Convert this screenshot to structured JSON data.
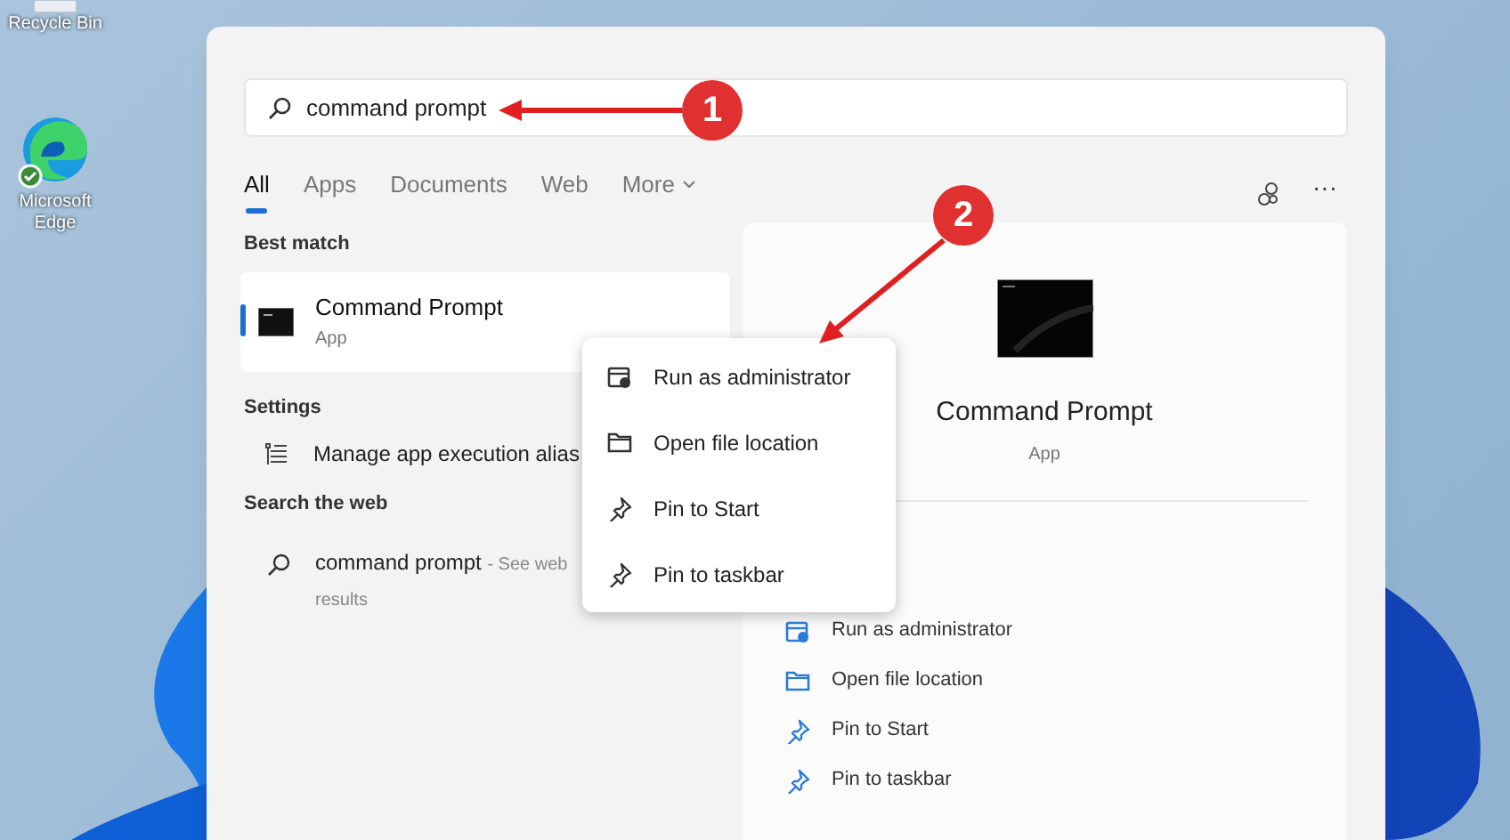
{
  "desktop_icons": [
    {
      "kind": "recycle-bin",
      "label": "Recycle Bin"
    },
    {
      "kind": "edge",
      "label": "Microsoft Edge"
    }
  ],
  "search": {
    "value": "command prompt"
  },
  "tabs": [
    {
      "label": "All",
      "selected": true,
      "dropdown": false
    },
    {
      "label": "Apps",
      "selected": false,
      "dropdown": false
    },
    {
      "label": "Documents",
      "selected": false,
      "dropdown": false
    },
    {
      "label": "Web",
      "selected": false,
      "dropdown": false
    },
    {
      "label": "More",
      "selected": false,
      "dropdown": true
    }
  ],
  "best_match": {
    "heading": "Best match",
    "title": "Command Prompt",
    "subtitle": "App",
    "selected": true
  },
  "settings": {
    "heading": "Settings",
    "items": [
      {
        "label": "Manage app execution alias"
      }
    ]
  },
  "search_the_web": {
    "heading": "Search the web",
    "query": "command prompt",
    "suffix": "- See web results"
  },
  "more_options": "···",
  "context_menu": [
    {
      "kind": "admin",
      "label": "Run as administrator"
    },
    {
      "kind": "folder",
      "label": "Open file location"
    },
    {
      "kind": "pin",
      "label": "Pin to Start"
    },
    {
      "kind": "pin",
      "label": "Pin to taskbar"
    }
  ],
  "details": {
    "title": "Command Prompt",
    "subtitle": "App",
    "actions": [
      {
        "kind": "admin",
        "label": "Run as administrator"
      },
      {
        "kind": "folder",
        "label": "Open file location"
      },
      {
        "kind": "pin",
        "label": "Pin to Start"
      },
      {
        "kind": "pin",
        "label": "Pin to taskbar"
      }
    ]
  },
  "callouts": [
    {
      "number": "1"
    },
    {
      "number": "2"
    }
  ]
}
